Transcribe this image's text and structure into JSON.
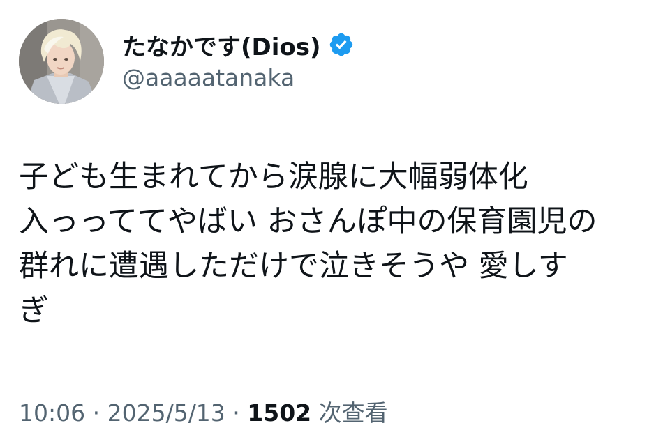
{
  "author": {
    "display_name": "たなかです(Dios)",
    "handle": "@aaaaatanaka",
    "verified_icon": "verified-badge-icon",
    "verified_color": "#1d9bf0"
  },
  "tweet": {
    "lines": [
      "子ども生まれてから涙腺に大幅弱体化",
      "入っっててやばい おさんぽ中の保育園児の",
      "群れに遭遇しただけで泣きそうや 愛しす",
      "ぎ"
    ]
  },
  "meta": {
    "time": "10:06",
    "separator_1": " · ",
    "date": "2025/5/13",
    "separator_2": " · ",
    "views_count": "1502",
    "views_label": " 次查看"
  },
  "colors": {
    "text_primary": "#0f1419",
    "text_secondary": "#536471",
    "background": "#ffffff"
  }
}
